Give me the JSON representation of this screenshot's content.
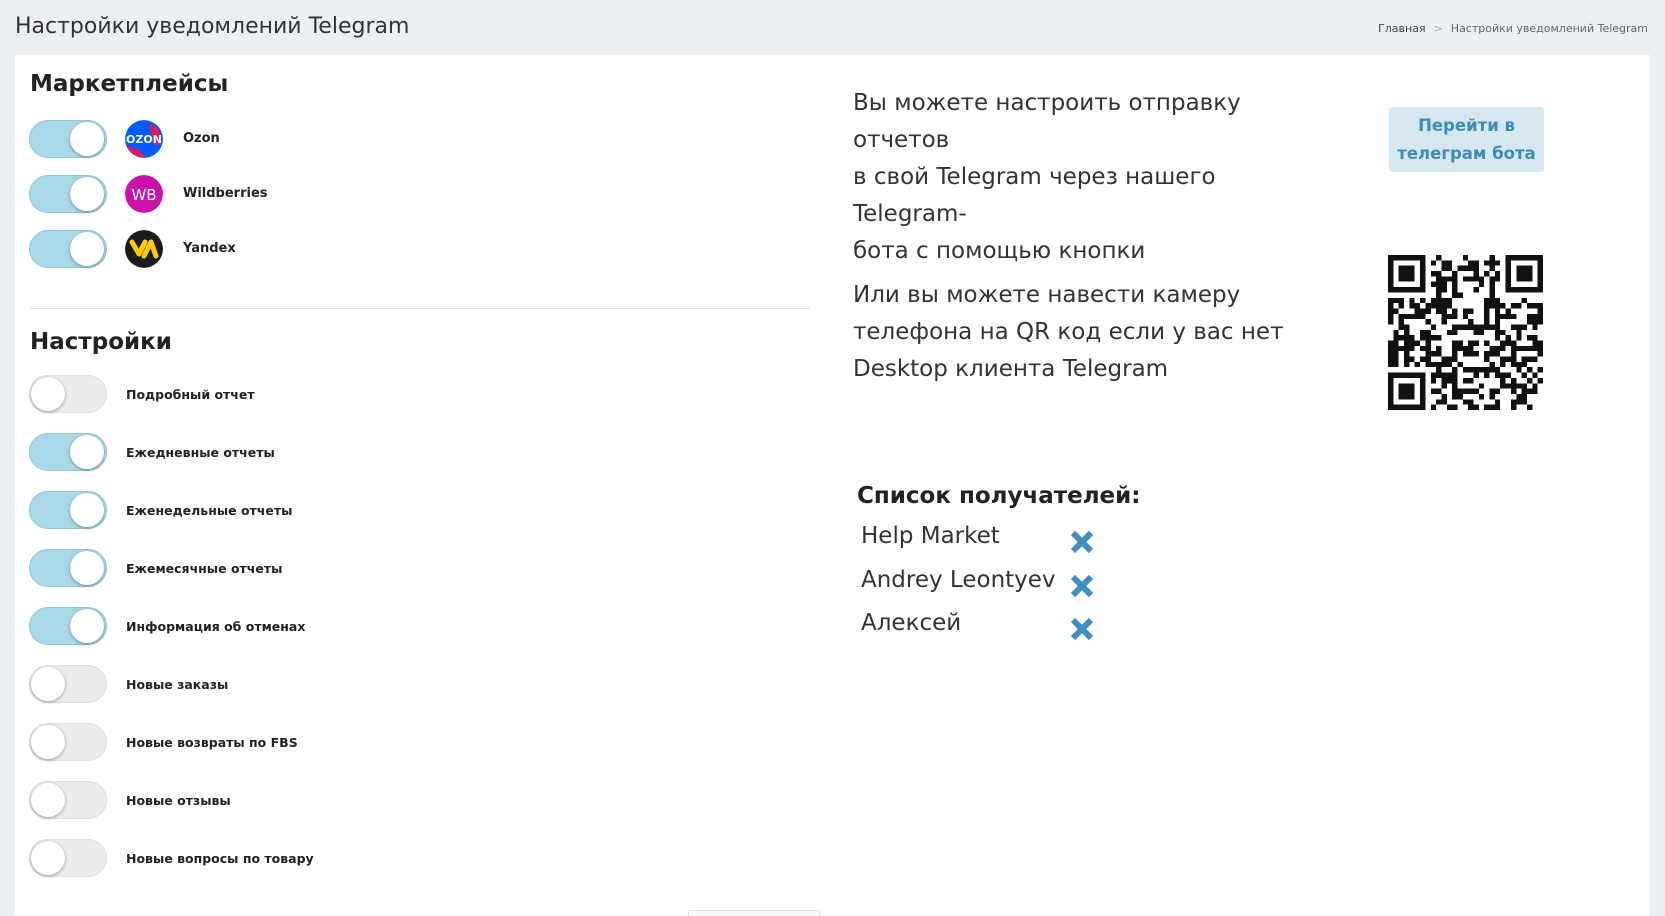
{
  "header": {
    "title": "Настройки уведомлений Telegram",
    "breadcrumb": {
      "home": "Главная",
      "separator": ">",
      "current": "Настройки уведомлений Telegram"
    }
  },
  "marketplaces": {
    "title": "Маркетплейсы",
    "items": [
      {
        "label": "Ozon",
        "enabled": true,
        "logo": "ozon-logo",
        "logo_text": "OZON",
        "color": "#005bff"
      },
      {
        "label": "Wildberries",
        "enabled": true,
        "logo": "wildberries-logo",
        "logo_text": "WB",
        "color": "#cb11ab"
      },
      {
        "label": "Yandex",
        "enabled": true,
        "logo": "yandex-market-logo",
        "color": "#ffcc00"
      }
    ]
  },
  "settings": {
    "title": "Настройки",
    "items": [
      {
        "label": "Подробный отчет",
        "enabled": false
      },
      {
        "label": "Ежедневные отчеты",
        "enabled": true
      },
      {
        "label": "Еженедельные отчеты",
        "enabled": true
      },
      {
        "label": "Ежемесячные отчеты",
        "enabled": true
      },
      {
        "label": "Информация об отменах",
        "enabled": true
      },
      {
        "label": "Новые заказы",
        "enabled": false
      },
      {
        "label": "Новые возвраты по FBS",
        "enabled": false
      },
      {
        "label": "Новые отзывы",
        "enabled": false
      },
      {
        "label": "Новые вопросы по товару",
        "enabled": false
      }
    ]
  },
  "telegram": {
    "info_lines": [
      "Вы можете настроить отправку отчетов",
      "в свой Telegram через нашего Telegram-",
      "бота с помощью кнопки"
    ],
    "button_lines": [
      "Перейти в",
      "телеграм бота"
    ],
    "qr_info_lines": [
      "Или вы можете навести камеру",
      "телефона на QR код если у вас нет",
      "Desktop клиента Telegram"
    ]
  },
  "recipients": {
    "title": "Список получателей:",
    "items": [
      "Help Market",
      "Andrey Leontyev",
      "Алексей"
    ]
  },
  "colors": {
    "toggle_on": "#a9d8e6",
    "toggle_off": "#ebebeb",
    "remove_icon": "#3d8ec2",
    "button_text": "#3a8cbd",
    "button_bg": "#d6e7f0"
  }
}
